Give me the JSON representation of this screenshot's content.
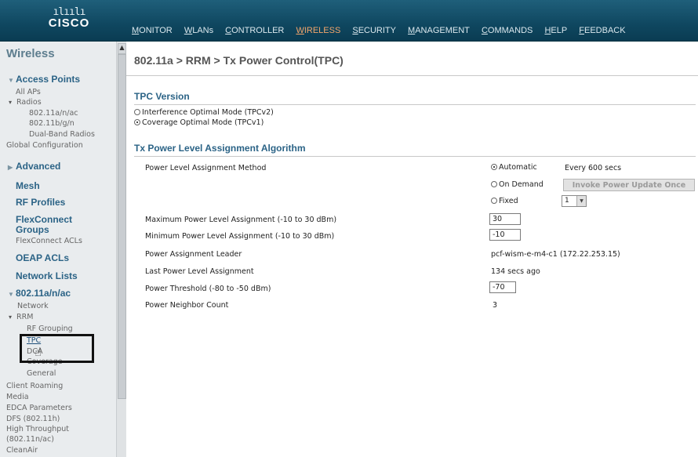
{
  "logo": {
    "bars": "ılıılı",
    "word": "CISCO"
  },
  "nav": [
    "MONITOR",
    "WLANs",
    "CONTROLLER",
    "WIRELESS",
    "SECURITY",
    "MANAGEMENT",
    "COMMANDS",
    "HELP",
    "FEEDBACK"
  ],
  "nav_active": "WIRELESS",
  "leftnav": {
    "title": "Wireless",
    "access_points": "Access Points",
    "all_aps": "All APs",
    "radios": "Radios",
    "radio_a": "802.11a/n/ac",
    "radio_b": "802.11b/g/n",
    "dual_band": "Dual-Band Radios",
    "global_config": "Global Configuration",
    "advanced": "Advanced",
    "mesh": "Mesh",
    "rf_profiles": "RF Profiles",
    "flexconnect_groups": "FlexConnect Groups",
    "flexconnect_acls": "FlexConnect ACLs",
    "oeap_acls": "OEAP ACLs",
    "network_lists": "Network Lists",
    "band": "802.11a/n/ac",
    "network": "Network",
    "rrm": "RRM",
    "rf_grouping": "RF Grouping",
    "tpc": "TPC",
    "dca": "DCA",
    "coverage": "Coverage",
    "general": "General",
    "client_roaming": "Client Roaming",
    "media": "Media",
    "edca": "EDCA Parameters",
    "dfs": "DFS (802.11h)",
    "ht1": "High Throughput",
    "ht2": "(802.11n/ac)",
    "cleanair": "CleanAir"
  },
  "page": {
    "title": "802.11a > RRM > Tx Power Control(TPC)",
    "tpc_version_heading": "TPC Version",
    "tpc_v2": "Interference Optimal Mode (TPCv2)",
    "tpc_v1": "Coverage Optimal Mode (TPCv1)",
    "algo_heading": "Tx Power Level Assignment Algorithm",
    "method_label": "Power Level Assignment Method",
    "automatic": "Automatic",
    "every": "Every 600 secs",
    "on_demand": "On Demand",
    "invoke_button": "Invoke Power Update Once",
    "fixed": "Fixed",
    "fixed_value": "1",
    "max_label": "Maximum Power Level Assignment (-10 to 30 dBm)",
    "max_value": "30",
    "min_label": "Minimum Power Level Assignment (-10 to 30 dBm)",
    "min_value": "-10",
    "leader_label": "Power Assignment Leader",
    "leader_value": "pcf-wism-e-m4-c1 (172.22.253.15)",
    "last_label": "Last Power Level Assignment",
    "last_value": "134 secs ago",
    "threshold_label": "Power Threshold (-80 to -50 dBm)",
    "threshold_value": "-70",
    "neighbor_label": "Power Neighbor Count",
    "neighbor_value": "3"
  }
}
